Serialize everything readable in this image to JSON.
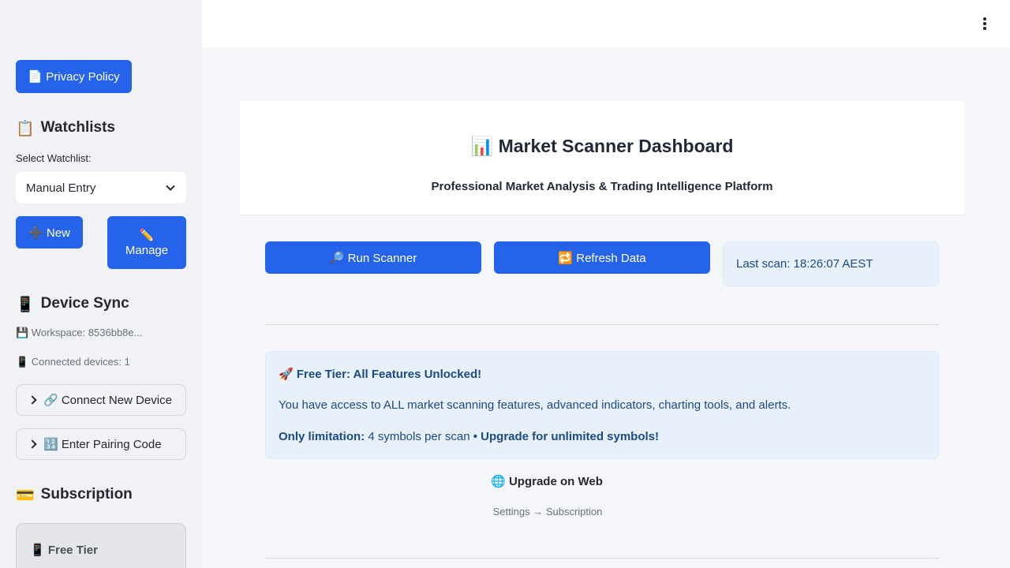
{
  "sidebar": {
    "privacy_button": "📄 Privacy Policy",
    "watchlists": {
      "icon": "📋",
      "title": "Watchlists"
    },
    "select_label": "Select Watchlist:",
    "select_value": "Manual Entry",
    "new_button": "➕ New",
    "manage_button_icon": "✏️",
    "manage_button_label": "Manage",
    "device_sync": {
      "icon": "📱",
      "title": "Device Sync"
    },
    "workspace_text": "💾 Workspace: 8536bb8e...",
    "connected_text": "📱 Connected devices: 1",
    "connect_expander": "🔗 Connect New Device",
    "pairing_expander": "🔢 Enter Pairing Code",
    "subscription": {
      "icon": "💳",
      "title": "Subscription"
    },
    "tier_label": "📱 Free Tier"
  },
  "main": {
    "title_icon": "📊",
    "title": "Market Scanner Dashboard",
    "subtitle": "Professional Market Analysis & Trading Intelligence Platform",
    "run_button": "🔎 Run Scanner",
    "refresh_button": "🔁 Refresh Data",
    "last_scan": "Last scan: 18:26:07 AEST",
    "free_tier": {
      "heading_icon": "🚀",
      "heading": "Free Tier: All Features Unlocked!",
      "body": "You have access to ALL market scanning features, advanced indicators, charting tools, and alerts.",
      "limit_label": "Only limitation:",
      "limit_value": " 4 symbols per scan ",
      "limit_sep": "• ",
      "limit_upgrade": "Upgrade for unlimited symbols!"
    },
    "upgrade_icon": "🌐",
    "upgrade_title": "Upgrade on Web",
    "upgrade_path": "Settings → Subscription"
  },
  "colors": {
    "accent": "#2563eb",
    "sidebar_bg": "#f0f2f6",
    "info_bg": "#e8f1fb",
    "info_text": "#1a4a84"
  },
  "icons": {
    "menu": "kebab-menu-icon",
    "dropdown": "chevron-down-icon",
    "expander": "chevron-right-icon"
  }
}
